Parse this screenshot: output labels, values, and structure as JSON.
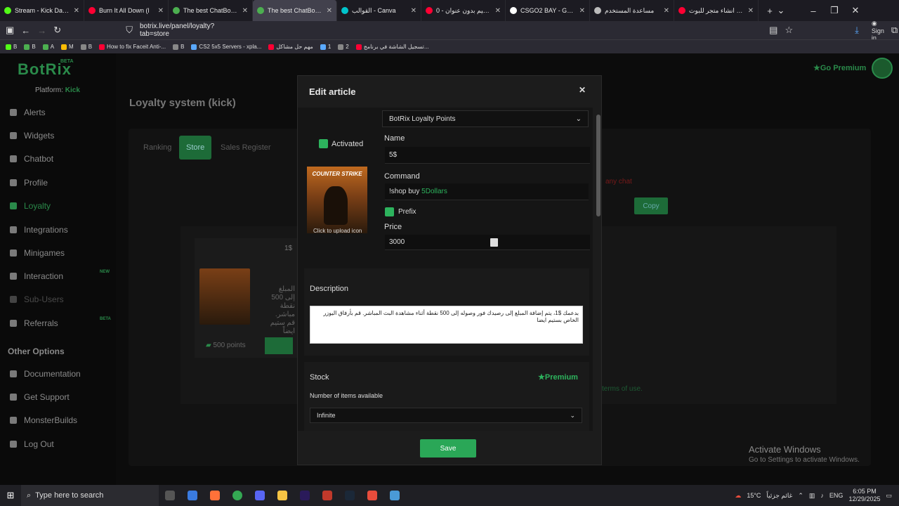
{
  "browser": {
    "tabs": [
      {
        "title": "Stream - Kick Dashboa",
        "color": "#53fc18"
      },
      {
        "title": "Burn It All Down (l",
        "color": "#ff0033"
      },
      {
        "title": "The best ChatBot and",
        "color": "#4caf50"
      },
      {
        "title": "The best ChatBot and",
        "color": "#4caf50",
        "active": true
      },
      {
        "title": "القوالب - Canva",
        "color": "#00c4cc"
      },
      {
        "title": "تصميم بدون عنوان - 0",
        "color": "#ff0033"
      },
      {
        "title": "CSGO2 BAY - Google S",
        "color": "#ffffff"
      },
      {
        "title": "مساعدة المستخدم",
        "color": "#bbbbbb"
      },
      {
        "title": "طريقة انشاء متجر للبوت",
        "color": "#ff0033"
      }
    ],
    "url": "botrix.live/panel/loyalty?tab=store",
    "signin": "Sign in",
    "bookmarks": [
      "B",
      "B",
      "A",
      "M",
      "B",
      "How to fix Faceit Anti-...",
      "B",
      "CS2 5x5 Servers - xpla...",
      "مهم حل مشاكل",
      "1",
      "2",
      "تسجيل الشاشة في برنامج..."
    ]
  },
  "sidebar": {
    "logo": "BotRix",
    "beta": "BETA",
    "platform_label": "Platform:",
    "platform_value": "Kick",
    "items": [
      {
        "label": "Alerts"
      },
      {
        "label": "Widgets"
      },
      {
        "label": "Chatbot"
      },
      {
        "label": "Profile"
      },
      {
        "label": "Loyalty"
      },
      {
        "label": "Integrations"
      },
      {
        "label": "Minigames"
      },
      {
        "label": "Interaction"
      },
      {
        "label": "Sub-Users"
      },
      {
        "label": "Referrals"
      }
    ],
    "new_badge": "NEW",
    "beta_badge": "BETA",
    "other_title": "Other Options",
    "other_items": [
      {
        "label": "Documentation"
      },
      {
        "label": "Get Support"
      },
      {
        "label": "MonsterBuilds"
      },
      {
        "label": "Log Out"
      }
    ]
  },
  "main": {
    "title": "Loyalty system (kick)",
    "tabs": [
      "Ranking",
      "Store",
      "Sales Register"
    ],
    "go_premium": "Go Premium",
    "red_note": "any chat",
    "copy": "Copy",
    "article_name": "1$",
    "article_desc": "المبلغ إلى 500 نقطة مباشر. قم ستيم ايضاً",
    "points": "500 points",
    "terms": "terms of use."
  },
  "modal": {
    "title": "Edit article",
    "currency_select": "BotRix Loyalty Points",
    "activated_label": "Activated",
    "name_label": "Name",
    "name_value": "5$",
    "command_label": "Command",
    "command_prefix": "!shop buy ",
    "command_value": "5Dollars",
    "prefix_label": "Prefix",
    "price_label": "Price",
    "price_value": "3000",
    "upload_caption": "Click to upload icon",
    "icon_text": "COUNTER STRIKE",
    "description_label": "Description",
    "description_value": "بدعمك $1، يتم إضافة المبلغ إلى رصيدك فور وصوله إلى 500 نقطة أثناء مشاهدة البث المباشر. قم بأرفاق اليوزر الخاص بستيم ايضا",
    "stock_label": "Stock",
    "premium_label": "Premium",
    "items_available_label": "Number of items available",
    "stock_select": "Infinite",
    "save_label": "Save"
  },
  "watermark": {
    "line1": "Activate Windows",
    "line2": "Go to Settings to activate Windows."
  },
  "taskbar": {
    "search_placeholder": "Type here to search",
    "weather": "15°C",
    "weather_desc": "غائم جزئياً",
    "lang": "ENG",
    "time": "6:05 PM",
    "date": "12/29/2025"
  }
}
